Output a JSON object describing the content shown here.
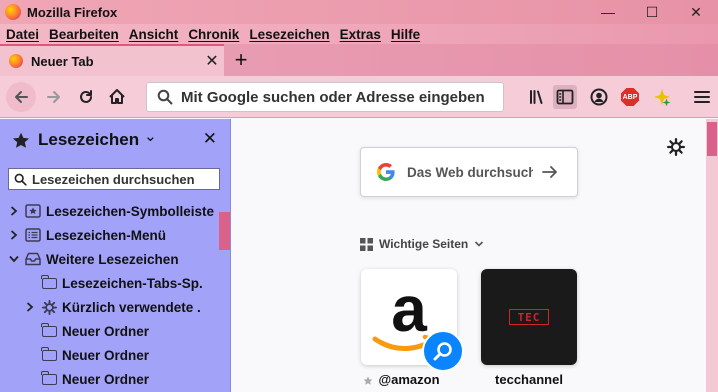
{
  "window": {
    "title": "Mozilla Firefox",
    "minimize": "—",
    "maximize": "☐",
    "close": "✕"
  },
  "menubar": {
    "items": [
      "Datei",
      "Bearbeiten",
      "Ansicht",
      "Chronik",
      "Lesezeichen",
      "Extras",
      "Hilfe"
    ]
  },
  "tabs": [
    {
      "label": "Neuer Tab",
      "close": "✕"
    }
  ],
  "newtab": "+",
  "urlbar": {
    "placeholder": "Mit Google suchen oder Adresse eingeben"
  },
  "sidebar": {
    "title": "Lesezeichen",
    "chevron": "⌄",
    "close": "✕",
    "search_placeholder": "Lesezeichen durchsuchen",
    "items": [
      {
        "label": "Lesezeichen-Symbolleiste",
        "icon": "bookmark-toolbar-icon",
        "twisty": "›",
        "indent": 0
      },
      {
        "label": "Lesezeichen-Menü",
        "icon": "bookmark-menu-icon",
        "twisty": "›",
        "indent": 0
      },
      {
        "label": "Weitere Lesezeichen",
        "icon": "other-bookmarks-icon",
        "twisty": "⌄",
        "indent": 0
      },
      {
        "label": "Lesezeichen-Tabs-Sp.",
        "icon": "folder-icon",
        "twisty": "",
        "indent": 1
      },
      {
        "label": "Kürzlich verwendete .",
        "icon": "gear-icon",
        "twisty": "›",
        "indent": 1
      },
      {
        "label": "Neuer Ordner",
        "icon": "folder-icon",
        "twisty": "",
        "indent": 1
      },
      {
        "label": "Neuer Ordner",
        "icon": "folder-icon",
        "twisty": "",
        "indent": 1
      },
      {
        "label": "Neuer Ordner",
        "icon": "folder-icon",
        "twisty": "",
        "indent": 1
      }
    ]
  },
  "newtab_page": {
    "search_placeholder": "Das Web durchsuchen",
    "topsites_label": "Wichtige Seiten",
    "tiles": [
      {
        "label": "@amazon"
      },
      {
        "label": "tecchannel",
        "logo_text": "TEC"
      }
    ]
  },
  "colors": {
    "titlebar": "#efa6b5",
    "sidebar_bg": "#a2a2f8",
    "accent": "#d8628a",
    "search_badge": "#0a84ff"
  }
}
